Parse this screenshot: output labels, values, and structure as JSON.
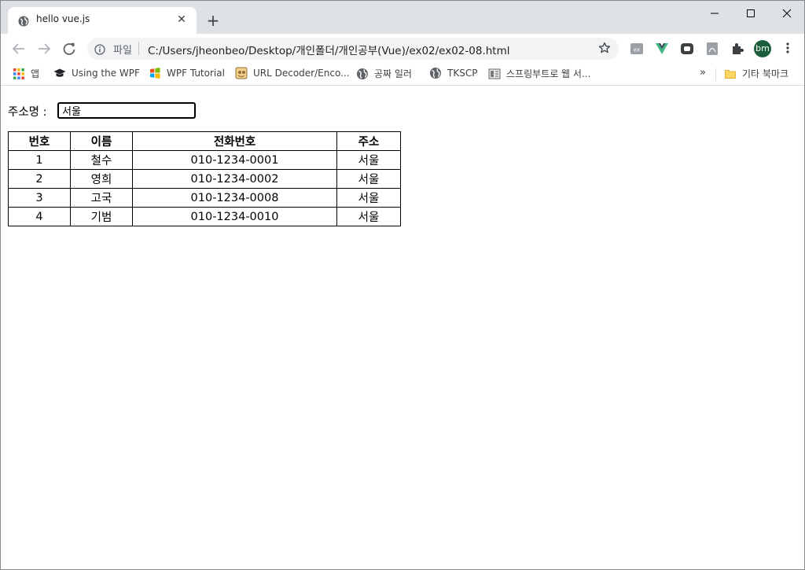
{
  "browser": {
    "tab_title": "hello vue.js",
    "tab_close_glyph": "✕",
    "new_tab_glyph": "+",
    "omnibox": {
      "scheme_label": "파일",
      "url": "C:/Users/jheonbeo/Desktop/개인폴더/개인공부(Vue)/ex02/ex02-08.html"
    },
    "avatar_initials": "bm",
    "bookmarks": [
      {
        "label": "앱",
        "icon": "apps-grid-icon"
      },
      {
        "label": "Using the WPF",
        "icon": "graduation-cap-icon"
      },
      {
        "label": "WPF Tutorial",
        "icon": "windows-logo-icon"
      },
      {
        "label": "URL Decoder/Enco...",
        "icon": "url-decoder-icon"
      },
      {
        "label": "공짜 일러",
        "icon": "globe-icon"
      },
      {
        "label": "TKSCP",
        "icon": "globe-icon"
      },
      {
        "label": "스프링부트로 웹 서...",
        "icon": "book-icon"
      }
    ],
    "bookmarks_overflow": "»",
    "other_bookmarks": {
      "label": "기타 북마크",
      "icon": "folder-icon"
    },
    "colors": {
      "titlebar": "#dee1e6",
      "omnibox_bg": "#f1f3f4",
      "vue_green": "#41b883",
      "avatar_bg": "#1b5e3b"
    }
  },
  "page": {
    "search": {
      "label": "주소명 :",
      "value": "서울"
    },
    "table": {
      "headers": [
        "번호",
        "이름",
        "전화번호",
        "주소"
      ],
      "rows": [
        [
          "1",
          "철수",
          "010-1234-0001",
          "서울"
        ],
        [
          "2",
          "영희",
          "010-1234-0002",
          "서울"
        ],
        [
          "3",
          "고국",
          "010-1234-0008",
          "서울"
        ],
        [
          "4",
          "기범",
          "010-1234-0010",
          "서울"
        ]
      ]
    }
  }
}
